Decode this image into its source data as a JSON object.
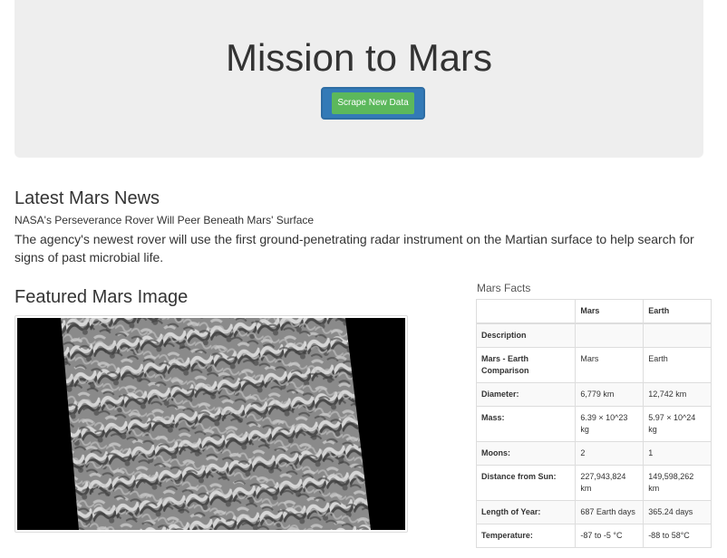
{
  "header": {
    "title": "Mission to Mars",
    "scrape_button_label": "Scrape New Data"
  },
  "news": {
    "heading": "Latest Mars News",
    "title": "NASA's Perseverance Rover Will Peer Beneath Mars' Surface",
    "paragraph": "The agency's newest rover will use the first ground-penetrating radar instrument on the Martian surface to help search for signs of past microbial life."
  },
  "featured_image": {
    "heading": "Featured Mars Image"
  },
  "facts": {
    "caption": "Mars Facts",
    "columns": [
      "",
      "Mars",
      "Earth"
    ],
    "rows": [
      {
        "label": "Description",
        "mars": "",
        "earth": ""
      },
      {
        "label": "Mars - Earth Comparison",
        "mars": "Mars",
        "earth": "Earth"
      },
      {
        "label": "Diameter:",
        "mars": "6,779 km",
        "earth": "12,742 km"
      },
      {
        "label": "Mass:",
        "mars": "6.39 × 10^23 kg",
        "earth": "5.97 × 10^24 kg"
      },
      {
        "label": "Moons:",
        "mars": "2",
        "earth": "1"
      },
      {
        "label": "Distance from Sun:",
        "mars": "227,943,824 km",
        "earth": "149,598,262 km"
      },
      {
        "label": "Length of Year:",
        "mars": "687 Earth days",
        "earth": "365.24 days"
      },
      {
        "label": "Temperature:",
        "mars": "-87 to -5 °C",
        "earth": "-88 to 58°C"
      }
    ]
  }
}
